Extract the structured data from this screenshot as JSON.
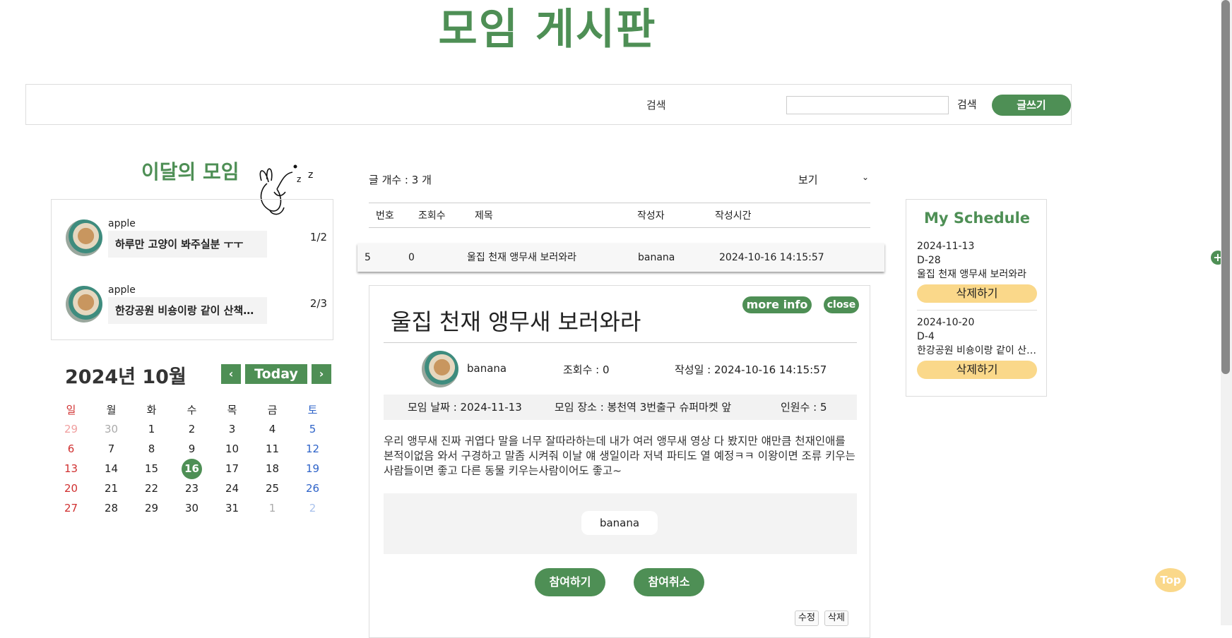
{
  "header": {
    "title": "모임 게시판"
  },
  "search": {
    "select_label": "검색",
    "button_label": "검색",
    "write_label": "글쓰기",
    "input_value": ""
  },
  "monthly": {
    "title": "이달의 모임",
    "items": [
      {
        "author": "apple",
        "title": "하루만 고양이 봐주실분 ㅜㅜ",
        "ratio": "1/2"
      },
      {
        "author": "apple",
        "title": "한강공원 비숑이랑 같이 산책…",
        "ratio": "2/3"
      }
    ]
  },
  "calendar": {
    "title": "2024년 10월",
    "today_label": "Today",
    "prev_icon": "‹",
    "next_icon": "›",
    "weekdays": [
      "일",
      "월",
      "화",
      "수",
      "목",
      "금",
      "토"
    ],
    "weeks": [
      [
        "29",
        "30",
        "1",
        "2",
        "3",
        "4",
        "5"
      ],
      [
        "6",
        "7",
        "8",
        "9",
        "10",
        "11",
        "12"
      ],
      [
        "13",
        "14",
        "15",
        "16",
        "17",
        "18",
        "19"
      ],
      [
        "20",
        "21",
        "22",
        "23",
        "24",
        "25",
        "26"
      ],
      [
        "27",
        "28",
        "29",
        "30",
        "31",
        "1",
        "2"
      ]
    ],
    "today": "16"
  },
  "board": {
    "count_label": "글 개수 : 3 개",
    "view_label": "보기",
    "columns": [
      "번호",
      "조회수",
      "제목",
      "작성자",
      "작성시간"
    ],
    "row": {
      "no": "5",
      "views": "0",
      "title": "울집 천재 앵무새 보러와라",
      "author": "banana",
      "time": "2024-10-16 14:15:57",
      "action": "+"
    }
  },
  "detail": {
    "title": "울집 천재 앵무새 보러와라",
    "more_info": "more info",
    "close": "close",
    "author": "banana",
    "views": "조회수 : 0",
    "date": "작성일 : 2024-10-16 14:15:57",
    "meet_date": "모임 날짜 : 2024-11-13",
    "meet_place": "모임 장소 : 봉천역 3번출구 슈퍼마켓 앞",
    "people": "인원수 : 5",
    "body": "우리 앵무새 진짜 귀엽다 말을 너무 잘따라하는데 내가 여러 앵무새 영상 다 봤지만 얘만큼 천재인애를 본적이없음 와서 구경하고 말좀 시켜줘 이날 얘 생일이라 저녁 파티도 열 예정ㅋㅋ 이왕이면 조류 키우는사람들이면 좋고 다른 동물 키우는사람이어도 좋고~",
    "participant": "banana",
    "join": "참여하기",
    "cancel": "참여취소",
    "edit": "수정",
    "delete": "삭제"
  },
  "schedule": {
    "title": "My Schedule",
    "items": [
      {
        "date": "2024-11-13",
        "dday": "D-28",
        "title": "울집 천재 앵무새 보러와라",
        "btn": "삭제하기"
      },
      {
        "date": "2024-10-20",
        "dday": "D-4",
        "title": "한강공원 비숑이랑 같이 산…",
        "btn": "삭제하기"
      }
    ]
  },
  "top_button": "Top",
  "colors": {
    "brand": "#4e8f55",
    "accent": "#fad88a",
    "sunday": "#d03030",
    "saturday": "#2f64c9"
  }
}
